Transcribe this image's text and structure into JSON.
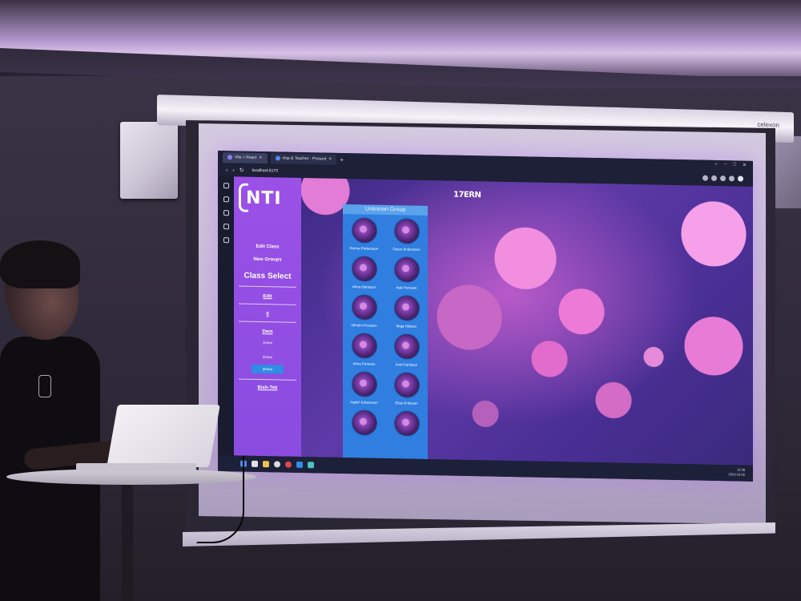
{
  "browser": {
    "tabs": [
      {
        "label": "Vite + React",
        "active": true
      },
      {
        "label": "nlsp & Teacher - Present",
        "active": false
      }
    ],
    "url": "localhost:5173"
  },
  "screen_brand": "celexon",
  "app": {
    "logo": "NTI",
    "title": "17ERN",
    "sidebar": {
      "edit_class": "Edit Class",
      "new_groups": "New Groups",
      "class_select": "Class Select",
      "option_1": "Edit",
      "option_2": "0",
      "option_3": "Dem",
      "sizes": [
        "10mm",
        "20mm",
        "30mm"
      ],
      "selected_size": "30mm",
      "footer_link": "Bish-Tek"
    },
    "group": {
      "header": "Unknown Group",
      "students": [
        "Emma Pettersson",
        "Oscar Andersson",
        "Alma Hansson",
        "Isak Persson",
        "Vilhelm Persson",
        "Maja Nilsson",
        "Alma Persson",
        "Axel Karlsson",
        "Ingrid Johansson",
        "Elias Eriksson",
        "",
        ""
      ]
    }
  },
  "taskbar": {
    "time": "12:38",
    "date": "2023-12-02"
  },
  "colors": {
    "sidebar": "#9b50e6",
    "group_panel": "#2f7ee0",
    "selected_button": "#2f8de4"
  }
}
